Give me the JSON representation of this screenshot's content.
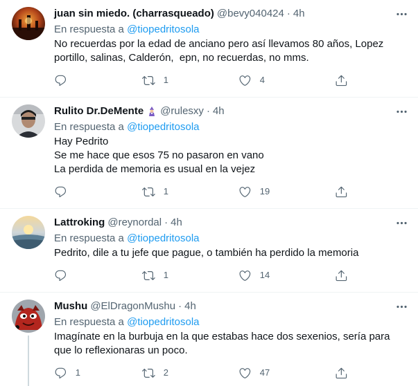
{
  "reply_prefix": "En respuesta a",
  "tweets": [
    {
      "name": "juan sin miedo. (charrasqueado)",
      "handle": "@bevy040424",
      "separator": "·",
      "time": "4h",
      "reply_to": "@tiopedritosola",
      "text": [
        "No recuerdas por la edad de anciano pero así llevamos 80 años, Lopez",
        "portillo, salinas, Calderón,  epn, no recuerdas, no mms."
      ],
      "replies": "",
      "retweets": "1",
      "likes": "4"
    },
    {
      "name": "Rulito Dr.DeMente",
      "handle": "@rulesxy",
      "separator": "·",
      "time": "4h",
      "reply_to": "@tiopedritosola",
      "text": [
        "Hay Pedrito",
        "Se me hace que esos 75 no pasaron en vano",
        "La perdida de memoria es usual en la vejez"
      ],
      "replies": "",
      "retweets": "1",
      "likes": "19"
    },
    {
      "name": "Lattroking",
      "handle": "@reynordal",
      "separator": "·",
      "time": "4h",
      "reply_to": "@tiopedritosola",
      "text": [
        "Pedrito, dile a tu jefe que pague, o también ha perdido la memoria"
      ],
      "replies": "",
      "retweets": "1",
      "likes": "14"
    },
    {
      "name": "Mushu",
      "handle": "@ElDragonMushu",
      "separator": "·",
      "time": "4h",
      "reply_to": "@tiopedritosola",
      "text": [
        "Imagínate en la burbuja en la que estabas hace dos sexenios, sería para",
        "que lo reflexionaras un poco."
      ],
      "replies": "1",
      "retweets": "2",
      "likes": "47"
    }
  ],
  "icons": {
    "reply": "reply-icon",
    "retweet": "retweet-icon",
    "like": "heart-icon",
    "share": "share-icon",
    "more": "more-icon"
  },
  "colors": {
    "link": "#1d9bf0",
    "secondary_text": "#536471",
    "divider": "#eff3f4"
  }
}
